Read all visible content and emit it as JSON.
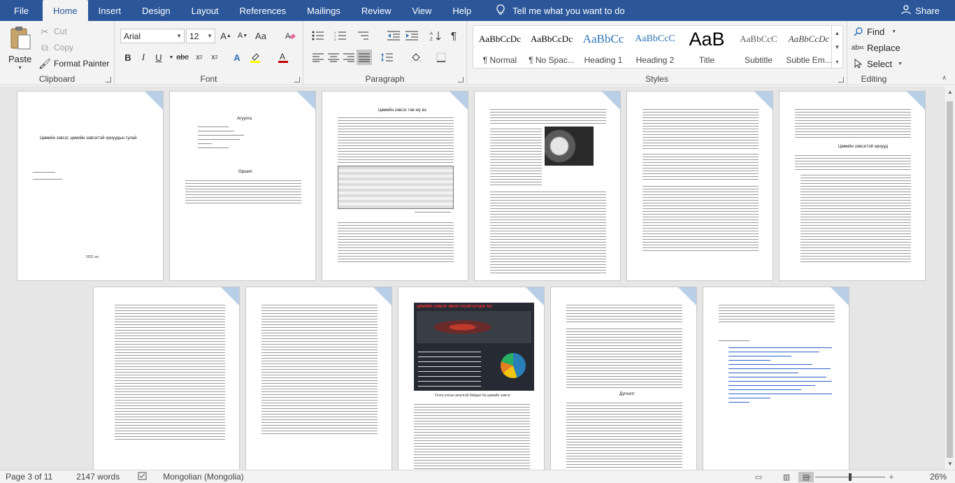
{
  "tabs": {
    "file": "File",
    "home": "Home",
    "insert": "Insert",
    "design": "Design",
    "layout": "Layout",
    "references": "References",
    "mailings": "Mailings",
    "review": "Review",
    "view": "View",
    "help": "Help",
    "tell_me": "Tell me what you want to do",
    "share": "Share"
  },
  "clipboard": {
    "label": "Clipboard",
    "paste": "Paste",
    "cut": "Cut",
    "copy": "Copy",
    "format_painter": "Format Painter"
  },
  "font": {
    "label": "Font",
    "family": "Arial",
    "size": "12"
  },
  "paragraph": {
    "label": "Paragraph"
  },
  "styles": {
    "label": "Styles",
    "items": [
      {
        "sample": "AaBbCcDc",
        "name": "¶ Normal"
      },
      {
        "sample": "AaBbCcDc",
        "name": "¶ No Spac..."
      },
      {
        "sample": "AaBbCc",
        "name": "Heading 1"
      },
      {
        "sample": "AaBbCcC",
        "name": "Heading 2"
      },
      {
        "sample": "AaB",
        "name": "Title"
      },
      {
        "sample": "AaBbCcC",
        "name": "Subtitle"
      },
      {
        "sample": "AaBbCcDc",
        "name": "Subtle Em..."
      }
    ]
  },
  "editing": {
    "label": "Editing",
    "find": "Find",
    "replace": "Replace",
    "select": "Select"
  },
  "pages": {
    "p1": {
      "title": "Цөмийн зэвсэг, цөмийн зэвсэгтэй орнуудын тулай",
      "footer": "2021 он"
    },
    "p2": {
      "heading1": "Агуулга",
      "heading2": "Оршил"
    },
    "p3": {
      "heading": "Цөмийн зэвсэг гэж юу вэ"
    },
    "p6": {
      "heading": "Цөмийн зэвсэгтэй орнууд"
    },
    "p9": {
      "infographic_title": "ЦӨМИЙН ЗЭВСЭГ ЯМАР УНЭЭР БҮТДЭГ ВЭ",
      "caption": "Олон улсын аюулгүй байдал ба цөмийн зэвсэг"
    },
    "p10": {
      "heading": "Дүгнэлт"
    }
  },
  "status": {
    "page": "Page 3 of 11",
    "words": "2147 words",
    "language": "Mongolian (Mongolia)",
    "zoom": "26%"
  },
  "colors": {
    "ribbon_blue": "#2b579a",
    "heading_blue": "#2e74b5",
    "font_color_red": "#c00000",
    "highlight_yellow": "#ffff00"
  }
}
